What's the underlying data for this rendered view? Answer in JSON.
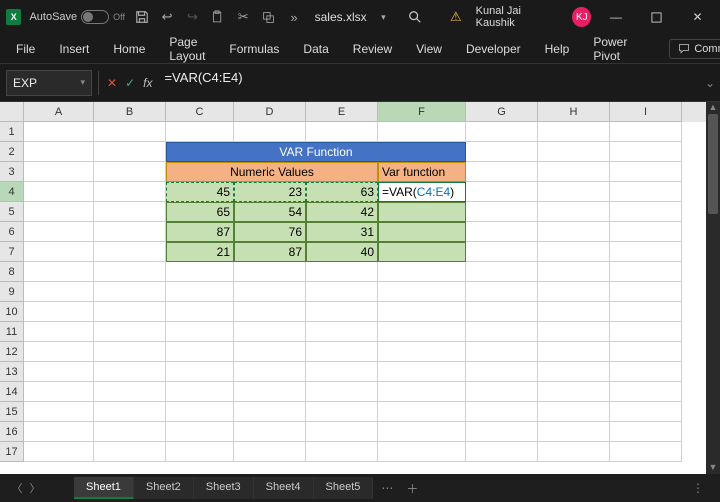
{
  "titlebar": {
    "autosave_label": "AutoSave",
    "autosave_state": "Off",
    "filename": "sales.xlsx",
    "user_name": "Kunal Jai Kaushik",
    "user_initials": "KJ"
  },
  "ribbon": {
    "tabs": [
      "File",
      "Insert",
      "Home",
      "Page Layout",
      "Formulas",
      "Data",
      "Review",
      "View",
      "Developer",
      "Help",
      "Power Pivot"
    ],
    "comments_label": "Comments"
  },
  "formula_bar": {
    "name_box": "EXP",
    "formula": "=VAR(C4:E4)"
  },
  "grid": {
    "columns": [
      {
        "label": "A",
        "w": 70
      },
      {
        "label": "B",
        "w": 72
      },
      {
        "label": "C",
        "w": 68
      },
      {
        "label": "D",
        "w": 72
      },
      {
        "label": "E",
        "w": 72
      },
      {
        "label": "F",
        "w": 88
      },
      {
        "label": "G",
        "w": 72
      },
      {
        "label": "H",
        "w": 72
      },
      {
        "label": "I",
        "w": 72
      }
    ],
    "row_count": 17,
    "active_col": "F",
    "active_row": 4,
    "title_cell": "VAR Function",
    "sub_left": "Numeric Values",
    "sub_right": "Var function",
    "edit_text_prefix": "=VAR(",
    "edit_text_ref": "C4:E4",
    "edit_text_suffix": ")",
    "data_rows": [
      {
        "c": "45",
        "d": "23",
        "e": "63"
      },
      {
        "c": "65",
        "d": "54",
        "e": "42"
      },
      {
        "c": "87",
        "d": "76",
        "e": "31"
      },
      {
        "c": "21",
        "d": "87",
        "e": "40"
      }
    ]
  },
  "sheets": {
    "tabs": [
      "Sheet1",
      "Sheet2",
      "Sheet3",
      "Sheet4",
      "Sheet5"
    ],
    "active": 0
  }
}
